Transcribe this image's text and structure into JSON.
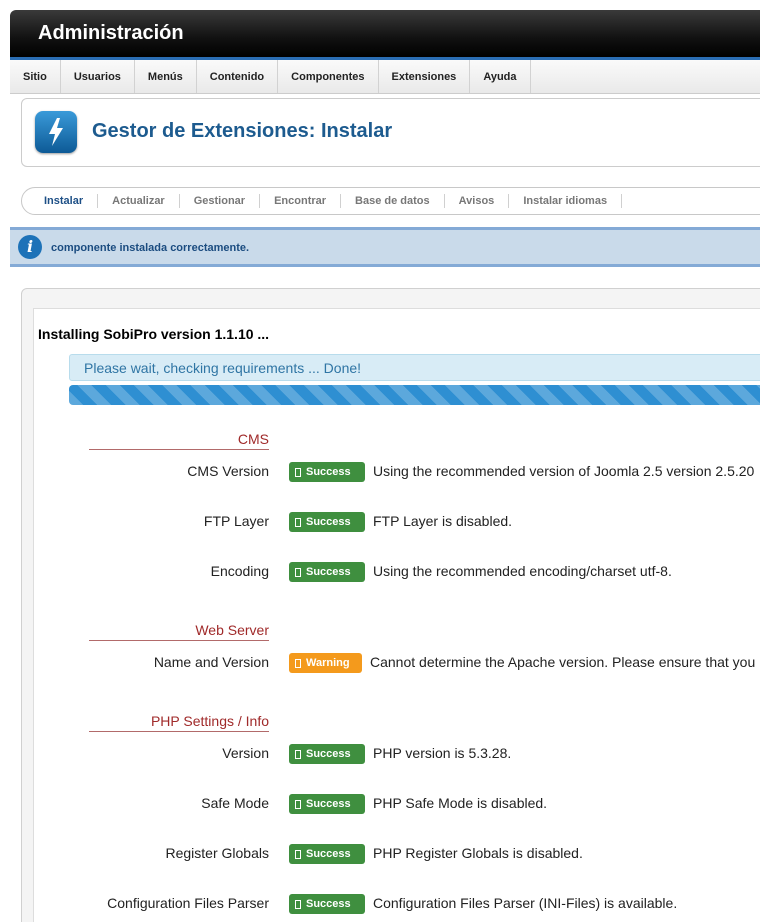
{
  "app_title": "Administración",
  "menu": [
    "Sitio",
    "Usuarios",
    "Menús",
    "Contenido",
    "Componentes",
    "Extensiones",
    "Ayuda"
  ],
  "page_title": "Gestor de Extensiones: Instalar",
  "subtabs": [
    "Instalar",
    "Actualizar",
    "Gestionar",
    "Encontrar",
    "Base de datos",
    "Avisos",
    "Instalar idiomas"
  ],
  "active_subtab": "Instalar",
  "message": "componente instalada correctamente.",
  "install_title": "Installing SobiPro version 1.1.10 ...",
  "wait_text": "Please wait, checking requirements ... Done!",
  "progress_percent": 100,
  "sections": {
    "cms": "CMS",
    "webserver": "Web Server",
    "php": "PHP Settings / Info"
  },
  "rows": {
    "cms_version": {
      "label": "CMS Version",
      "status": "Success",
      "message": "Using the recommended version of Joomla 2.5 version 2.5.20"
    },
    "ftp": {
      "label": "FTP Layer",
      "status": "Success",
      "message": "FTP Layer is disabled."
    },
    "encoding": {
      "label": "Encoding",
      "status": "Success",
      "message": "Using the recommended encoding/charset utf-8."
    },
    "name_version": {
      "label": "Name and Version",
      "status": "Warning",
      "message": "Cannot determine the Apache version. Please ensure that you"
    },
    "php_version": {
      "label": "Version",
      "status": "Success",
      "message": "PHP version is 5.3.28."
    },
    "safe_mode": {
      "label": "Safe Mode",
      "status": "Success",
      "message": "PHP Safe Mode is disabled."
    },
    "register_globals": {
      "label": "Register Globals",
      "status": "Success",
      "message": "PHP Register Globals is disabled."
    },
    "config_parser": {
      "label": "Configuration Files Parser",
      "status": "Success",
      "message": "Configuration Files Parser (INI-Files) is available."
    }
  },
  "colors": {
    "accent": "#1d5b8f",
    "success": "#3f8f3f",
    "warning": "#f49a1c",
    "section": "#a02a2a"
  }
}
